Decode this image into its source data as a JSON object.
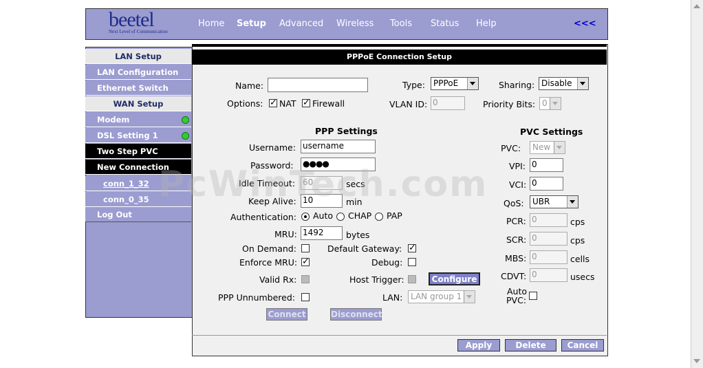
{
  "header": {
    "logo_text": "beetel",
    "logo_tagline": "Next Level of Communication",
    "nav": [
      "Home",
      "Setup",
      "Advanced",
      "Wireless",
      "Tools",
      "Status",
      "Help"
    ],
    "back_link": "<<<"
  },
  "sidebar": {
    "items": [
      {
        "label": "LAN Setup"
      },
      {
        "label": "LAN Configuration"
      },
      {
        "label": "Ethernet Switch"
      },
      {
        "label": "WAN Setup"
      },
      {
        "label": "Modem"
      },
      {
        "label": "DSL Setting 1"
      },
      {
        "label": "Two Step PVC"
      },
      {
        "label": "New Connection"
      },
      {
        "label": "conn_1_32"
      },
      {
        "label": "conn_0_35"
      },
      {
        "label": "Log Out"
      }
    ],
    "status_color": "#33cc33"
  },
  "main": {
    "title": "PPPoE Connection Setup",
    "name_label": "Name:",
    "name_value": "",
    "type_label": "Type:",
    "type_value": "PPPoE",
    "sharing_label": "Sharing:",
    "sharing_value": "Disable",
    "options_label": "Options:",
    "nat_label": "NAT",
    "firewall_label": "Firewall",
    "vlan_label": "VLAN ID:",
    "vlan_value": "0",
    "priority_label": "Priority Bits:",
    "priority_value": "0",
    "ppp_settings_heading": "PPP Settings",
    "pvc_settings_heading": "PVC Settings",
    "username_label": "Username:",
    "username_value": "username",
    "password_label": "Password:",
    "password_value": "●●●●",
    "idle_label": "Idle Timeout:",
    "idle_value": "60",
    "idle_unit": "secs",
    "keepalive_label": "Keep Alive:",
    "keepalive_value": "10",
    "keepalive_unit": "min",
    "auth_label": "Authentication:",
    "auth_options": [
      "Auto",
      "CHAP",
      "PAP"
    ],
    "mru_label": "MRU:",
    "mru_value": "1492",
    "mru_unit": "bytes",
    "ondemand_label": "On Demand:",
    "defgw_label": "Default Gateway:",
    "enforce_label": "Enforce MRU:",
    "debug_label": "Debug:",
    "validrx_label": "Valid Rx:",
    "hosttrigger_label": "Host Trigger:",
    "configure_label": "Configure",
    "unnumbered_label": "PPP Unnumbered:",
    "lan_label": "LAN:",
    "lan_value": "LAN group 1",
    "connect_label": "Connect",
    "disconnect_label": "Disconnect",
    "pvc_label": "PVC:",
    "pvc_value": "New",
    "vpi_label": "VPI:",
    "vpi_value": "0",
    "vci_label": "VCI:",
    "vci_value": "0",
    "qos_label": "QoS:",
    "qos_value": "UBR",
    "pcr_label": "PCR:",
    "pcr_value": "0",
    "pcr_unit": "cps",
    "scr_label": "SCR:",
    "scr_value": "0",
    "scr_unit": "cps",
    "mbs_label": "MBS:",
    "mbs_value": "0",
    "mbs_unit": "cells",
    "cdvt_label": "CDVT:",
    "cdvt_value": "0",
    "cdvt_unit": "usecs",
    "autopvc_label_1": "Auto",
    "autopvc_label_2": "PVC:",
    "apply_label": "Apply",
    "delete_label": "Delete",
    "cancel_label": "Cancel"
  },
  "watermark": "PcWinTech.com",
  "colors": {
    "brand": "#9b9cd0",
    "dark": "#000000",
    "link": "#0000cc"
  }
}
